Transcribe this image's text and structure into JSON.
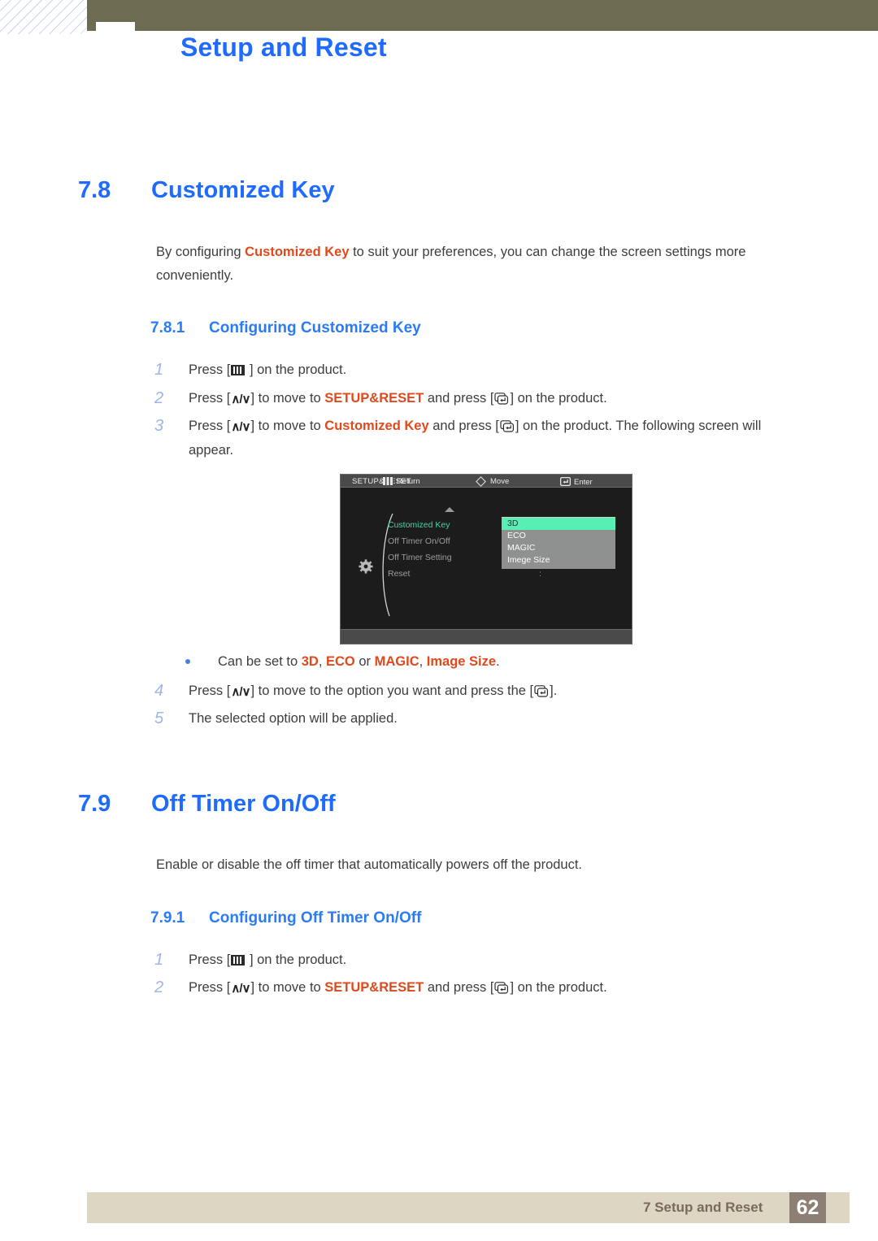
{
  "header": {
    "chapter_title": "Setup and Reset"
  },
  "sections": {
    "s78": {
      "number": "7.8",
      "title": "Customized Key",
      "intro_pre": "By configuring ",
      "intro_hl": "Customized Key",
      "intro_post": " to suit your preferences, you can change the screen settings more conveniently.",
      "sub": {
        "number": "7.8.1",
        "title": "Configuring Customized Key"
      },
      "steps": [
        {
          "index": "1",
          "parts": [
            {
              "t": "text",
              "v": "Press ["
            },
            {
              "t": "icon",
              "v": "menu-key-icon"
            },
            {
              "t": "text",
              "v": " ] on the product."
            }
          ]
        },
        {
          "index": "2",
          "parts": [
            {
              "t": "text",
              "v": "Press ["
            },
            {
              "t": "icon",
              "v": "up-down-key-icon"
            },
            {
              "t": "text",
              "v": "] to move to "
            },
            {
              "t": "hl",
              "v": "SETUP&RESET"
            },
            {
              "t": "text",
              "v": " and press ["
            },
            {
              "t": "icon",
              "v": "enter-key-icon"
            },
            {
              "t": "text",
              "v": "] on the product."
            }
          ]
        },
        {
          "index": "3",
          "parts": [
            {
              "t": "text",
              "v": "Press ["
            },
            {
              "t": "icon",
              "v": "up-down-key-icon"
            },
            {
              "t": "text",
              "v": "] to move to "
            },
            {
              "t": "hl",
              "v": "Customized Key"
            },
            {
              "t": "text",
              "v": " and press ["
            },
            {
              "t": "icon",
              "v": "enter-key-icon"
            },
            {
              "t": "text",
              "v": "] on the product. The following screen will appear."
            }
          ]
        },
        {
          "index": "4",
          "parts": [
            {
              "t": "text",
              "v": "Press ["
            },
            {
              "t": "icon",
              "v": "up-down-key-icon"
            },
            {
              "t": "text",
              "v": "] to move to the option you want and press the ["
            },
            {
              "t": "icon",
              "v": "enter-key-icon"
            },
            {
              "t": "text",
              "v": "]."
            }
          ]
        },
        {
          "index": "5",
          "parts": [
            {
              "t": "text",
              "v": "The selected option will be applied."
            }
          ]
        }
      ],
      "bullet": {
        "pre": "Can be set to ",
        "opt1": "3D",
        "sep1": ", ",
        "opt2": "ECO",
        "sep2": " or ",
        "opt3": "MAGIC",
        "sep3": ", ",
        "opt4": "Image Size",
        "post": "."
      }
    },
    "s79": {
      "number": "7.9",
      "title": "Off Timer On/Off",
      "intro": "Enable or disable the off timer that automatically powers off the product.",
      "sub": {
        "number": "7.9.1",
        "title": "Configuring Off Timer On/Off"
      },
      "steps": [
        {
          "index": "1",
          "parts": [
            {
              "t": "text",
              "v": "Press ["
            },
            {
              "t": "icon",
              "v": "menu-key-icon"
            },
            {
              "t": "text",
              "v": " ] on the product."
            }
          ]
        },
        {
          "index": "2",
          "parts": [
            {
              "t": "text",
              "v": "Press ["
            },
            {
              "t": "icon",
              "v": "up-down-key-icon"
            },
            {
              "t": "text",
              "v": "] to move to "
            },
            {
              "t": "hl",
              "v": "SETUP&RESET"
            },
            {
              "t": "text",
              "v": " and press ["
            },
            {
              "t": "icon",
              "v": "enter-key-icon"
            },
            {
              "t": "text",
              "v": "] on the product."
            }
          ]
        }
      ]
    }
  },
  "osd": {
    "title": "SETUP&RESET",
    "menu_items": [
      {
        "label": "Customized Key",
        "selected": true
      },
      {
        "label": "Off Timer On/Off",
        "selected": false
      },
      {
        "label": "Off Timer Setting",
        "selected": false
      },
      {
        "label": "Reset",
        "selected": false
      }
    ],
    "dropdown_options": [
      {
        "label": "3D",
        "highlighted": true
      },
      {
        "label": "ECO",
        "highlighted": false
      },
      {
        "label": "MAGIC",
        "highlighted": false
      },
      {
        "label": "Imege Size",
        "highlighted": false
      }
    ],
    "footer_buttons": [
      {
        "icon": "menu-key-icon",
        "label": "Return"
      },
      {
        "icon": "diamond-move-icon",
        "label": "Move"
      },
      {
        "icon": "enter-key-icon",
        "label": "Enter"
      }
    ]
  },
  "footer": {
    "chapter": "7 Setup and Reset",
    "page": "62"
  },
  "colors": {
    "heading_blue": "#1f6bff",
    "highlight_orange": "#e0491c",
    "header_bar": "#6e6b53",
    "footer_band": "#dcd6c2",
    "footer_pagebox": "#8d7f73",
    "osd_selected_green": "#43d6a0",
    "osd_option_green": "#57efb4"
  }
}
